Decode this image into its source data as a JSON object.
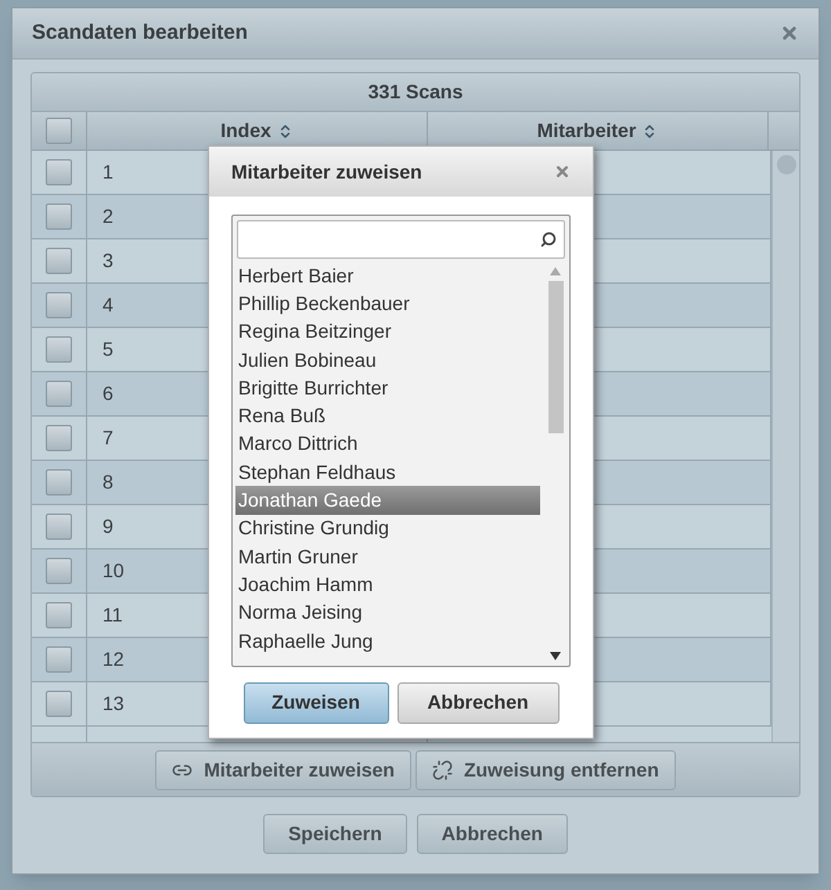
{
  "window": {
    "title": "Scandaten bearbeiten"
  },
  "table": {
    "caption": "331 Scans",
    "all_checked": false,
    "columns": [
      {
        "label": "Index"
      },
      {
        "label": "Mitarbeiter"
      }
    ],
    "rows": [
      {
        "index": "1",
        "checked": false
      },
      {
        "index": "2",
        "checked": false
      },
      {
        "index": "3",
        "checked": false
      },
      {
        "index": "4",
        "checked": false
      },
      {
        "index": "5",
        "checked": false
      },
      {
        "index": "6",
        "checked": false
      },
      {
        "index": "7",
        "checked": false
      },
      {
        "index": "8",
        "checked": false
      },
      {
        "index": "9",
        "checked": false
      },
      {
        "index": "10",
        "checked": false
      },
      {
        "index": "11",
        "checked": false
      },
      {
        "index": "12",
        "checked": false
      },
      {
        "index": "13",
        "checked": false
      }
    ]
  },
  "toolbar": [
    {
      "label": "Mitarbeiter zuweisen",
      "kind": "link"
    },
    {
      "label": "Zuweisung entfernen",
      "kind": "unlink"
    }
  ],
  "footer_buttons": [
    "Speichern",
    "Abbrechen"
  ],
  "assign_dialog": {
    "title": "Mitarbeiter zuweisen",
    "items": [
      {
        "name": "Herbert Baier",
        "selected": false
      },
      {
        "name": "Phillip Beckenbauer",
        "selected": false
      },
      {
        "name": "Regina Beitzinger",
        "selected": false
      },
      {
        "name": "Julien Bobineau",
        "selected": false
      },
      {
        "name": "Brigitte Burrichter",
        "selected": false
      },
      {
        "name": "Rena Buß",
        "selected": false
      },
      {
        "name": "Marco Dittrich",
        "selected": false
      },
      {
        "name": "Stephan Feldhaus",
        "selected": false
      },
      {
        "name": "Jonathan Gaede",
        "selected": true
      },
      {
        "name": "Christine Grundig",
        "selected": false
      },
      {
        "name": "Martin Gruner",
        "selected": false
      },
      {
        "name": "Joachim Hamm",
        "selected": false
      },
      {
        "name": "Norma Jeising",
        "selected": false
      },
      {
        "name": "Raphaelle Jung",
        "selected": false
      }
    ],
    "buttons": [
      {
        "label": "Zuweisen",
        "primary": true
      },
      {
        "label": "Abbrechen",
        "primary": false
      }
    ]
  }
}
